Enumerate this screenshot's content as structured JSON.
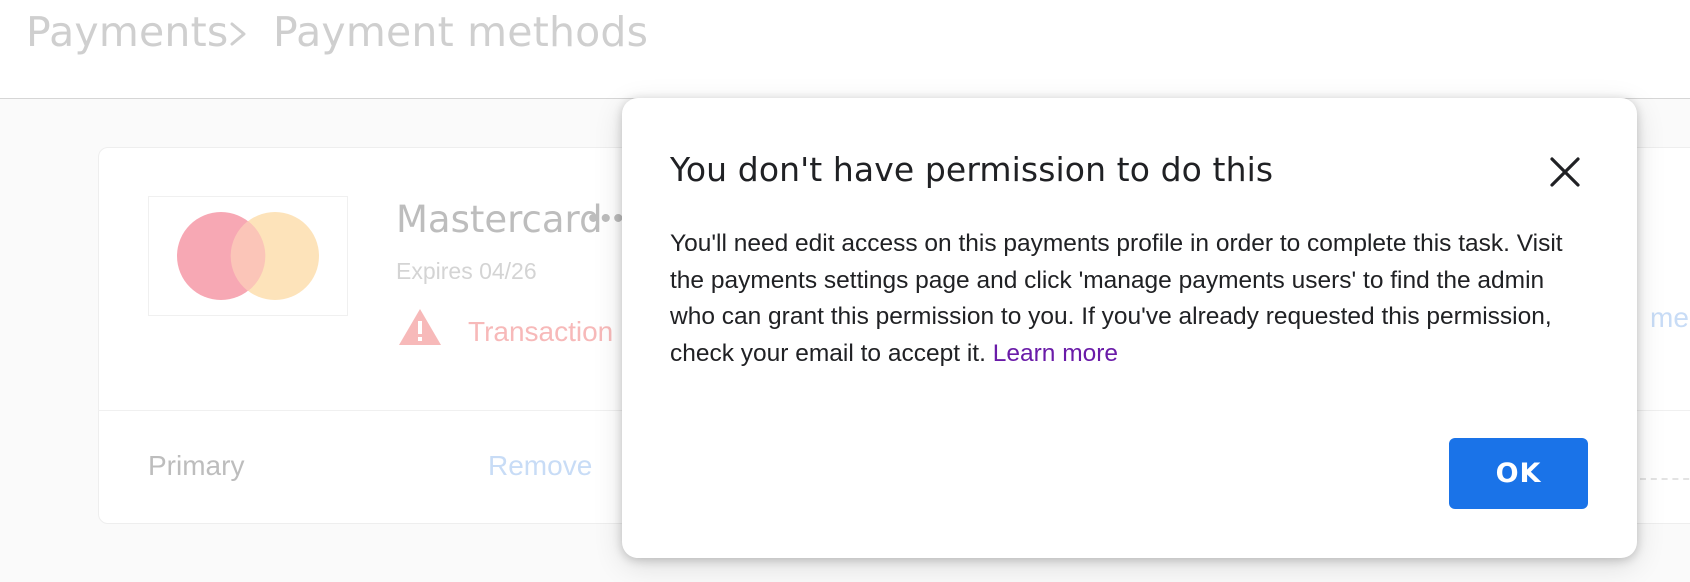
{
  "breadcrumb": {
    "items": [
      "Payments",
      "Payment methods"
    ],
    "separator_icon": "chevron-right-icon"
  },
  "payment_card": {
    "logo_icon": "mastercard-logo",
    "name": "Mastercard",
    "masked_dots": "•••",
    "expires": "Expires 04/26",
    "warning_icon": "warning-triangle-icon",
    "warning_text": "Transaction",
    "status_label": "Primary",
    "remove_label": "Remove",
    "manage_link_partial": "men"
  },
  "dialog": {
    "title": "You don't have permission to do this",
    "close_icon": "close-icon",
    "body": "You'll need edit access on this payments profile in order to complete this task. Visit the payments settings page and click 'manage payments users' to find the admin who can grant this permission to you. If you've already requested this permission, check your email to accept it.",
    "learn_more": "Learn more",
    "ok_label": "OK"
  },
  "colors": {
    "accent": "#1a73e8",
    "link_visited": "#6a1ba8",
    "mastercard_red": "#f7a8b4",
    "mastercard_orange": "#fde0b3",
    "warning": "#f7b9b9"
  }
}
